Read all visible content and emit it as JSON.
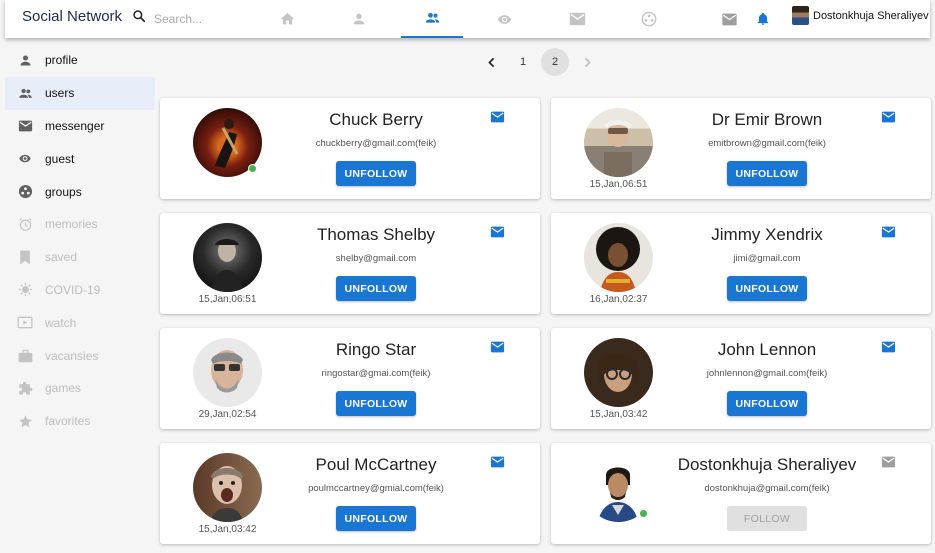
{
  "app": {
    "title": "Social Network"
  },
  "search": {
    "placeholder": "Search..."
  },
  "nav": {
    "tabs": [
      {
        "name": "home",
        "icon": "home-icon"
      },
      {
        "name": "profile",
        "icon": "person-icon"
      },
      {
        "name": "users",
        "icon": "people-icon",
        "active": true
      },
      {
        "name": "guest",
        "icon": "eye-icon"
      },
      {
        "name": "messenger",
        "icon": "mail-icon"
      },
      {
        "name": "groups",
        "icon": "groups-icon"
      }
    ]
  },
  "header_user": {
    "name": "Dostonkhuja Sheraliyev"
  },
  "sidebar": {
    "items": [
      {
        "label": "profile",
        "icon": "person-icon",
        "enabled": true
      },
      {
        "label": "users",
        "icon": "people-icon",
        "enabled": true,
        "selected": true
      },
      {
        "label": "messenger",
        "icon": "mail-icon",
        "enabled": true
      },
      {
        "label": "guest",
        "icon": "eye-icon",
        "enabled": true
      },
      {
        "label": "groups",
        "icon": "groups-icon",
        "enabled": true
      },
      {
        "label": "memories",
        "icon": "alarm-icon",
        "enabled": false
      },
      {
        "label": "saved",
        "icon": "bookmark-icon",
        "enabled": false
      },
      {
        "label": "COVID-19",
        "icon": "virus-icon",
        "enabled": false
      },
      {
        "label": "watch",
        "icon": "video-icon",
        "enabled": false
      },
      {
        "label": "vacansies",
        "icon": "briefcase-icon",
        "enabled": false
      },
      {
        "label": "games",
        "icon": "puzzle-icon",
        "enabled": false
      },
      {
        "label": "favorites",
        "icon": "star-icon",
        "enabled": false
      }
    ]
  },
  "pagination": {
    "pages": [
      "1",
      "2"
    ],
    "current": "2"
  },
  "users": [
    {
      "name": "Chuck Berry",
      "email": "chuckberry@gmail.com(feik)",
      "timestamp": "",
      "online": true,
      "button": "UNFOLLOW",
      "following": true
    },
    {
      "name": "Dr Emir Brown",
      "email": "emitbrown@gmail.com(feik)",
      "timestamp": "15,Jan,06:51",
      "online": false,
      "button": "UNFOLLOW",
      "following": true
    },
    {
      "name": "Thomas Shelby",
      "email": "shelby@gmail.com",
      "timestamp": "15,Jan,06:51",
      "online": false,
      "button": "UNFOLLOW",
      "following": true
    },
    {
      "name": "Jimmy Xendrix",
      "email": "jimi@gmail.com",
      "timestamp": "16,Jan,02:37",
      "online": false,
      "button": "UNFOLLOW",
      "following": true
    },
    {
      "name": "Ringo Star",
      "email": "ringostar@gmai.com(feik)",
      "timestamp": "29,Jan,02:54",
      "online": false,
      "button": "UNFOLLOW",
      "following": true
    },
    {
      "name": "John Lennon",
      "email": "johnlennon@gmail.com(feik)",
      "timestamp": "15,Jan,03:42",
      "online": false,
      "button": "UNFOLLOW",
      "following": true
    },
    {
      "name": "Poul McCartney",
      "email": "poulmccartney@gmial.com(feik)",
      "timestamp": "15,Jan,03:42",
      "online": false,
      "button": "UNFOLLOW",
      "following": true
    },
    {
      "name": "Dostonkhuja Sheraliyev",
      "email": "dostonkhuja@gmail.com(feik)",
      "timestamp": "",
      "online": true,
      "button": "FOLLOW",
      "following": false
    }
  ],
  "colors": {
    "accent": "#1976d2",
    "online": "#4caf50",
    "brand_text": "#1e2a4a"
  }
}
